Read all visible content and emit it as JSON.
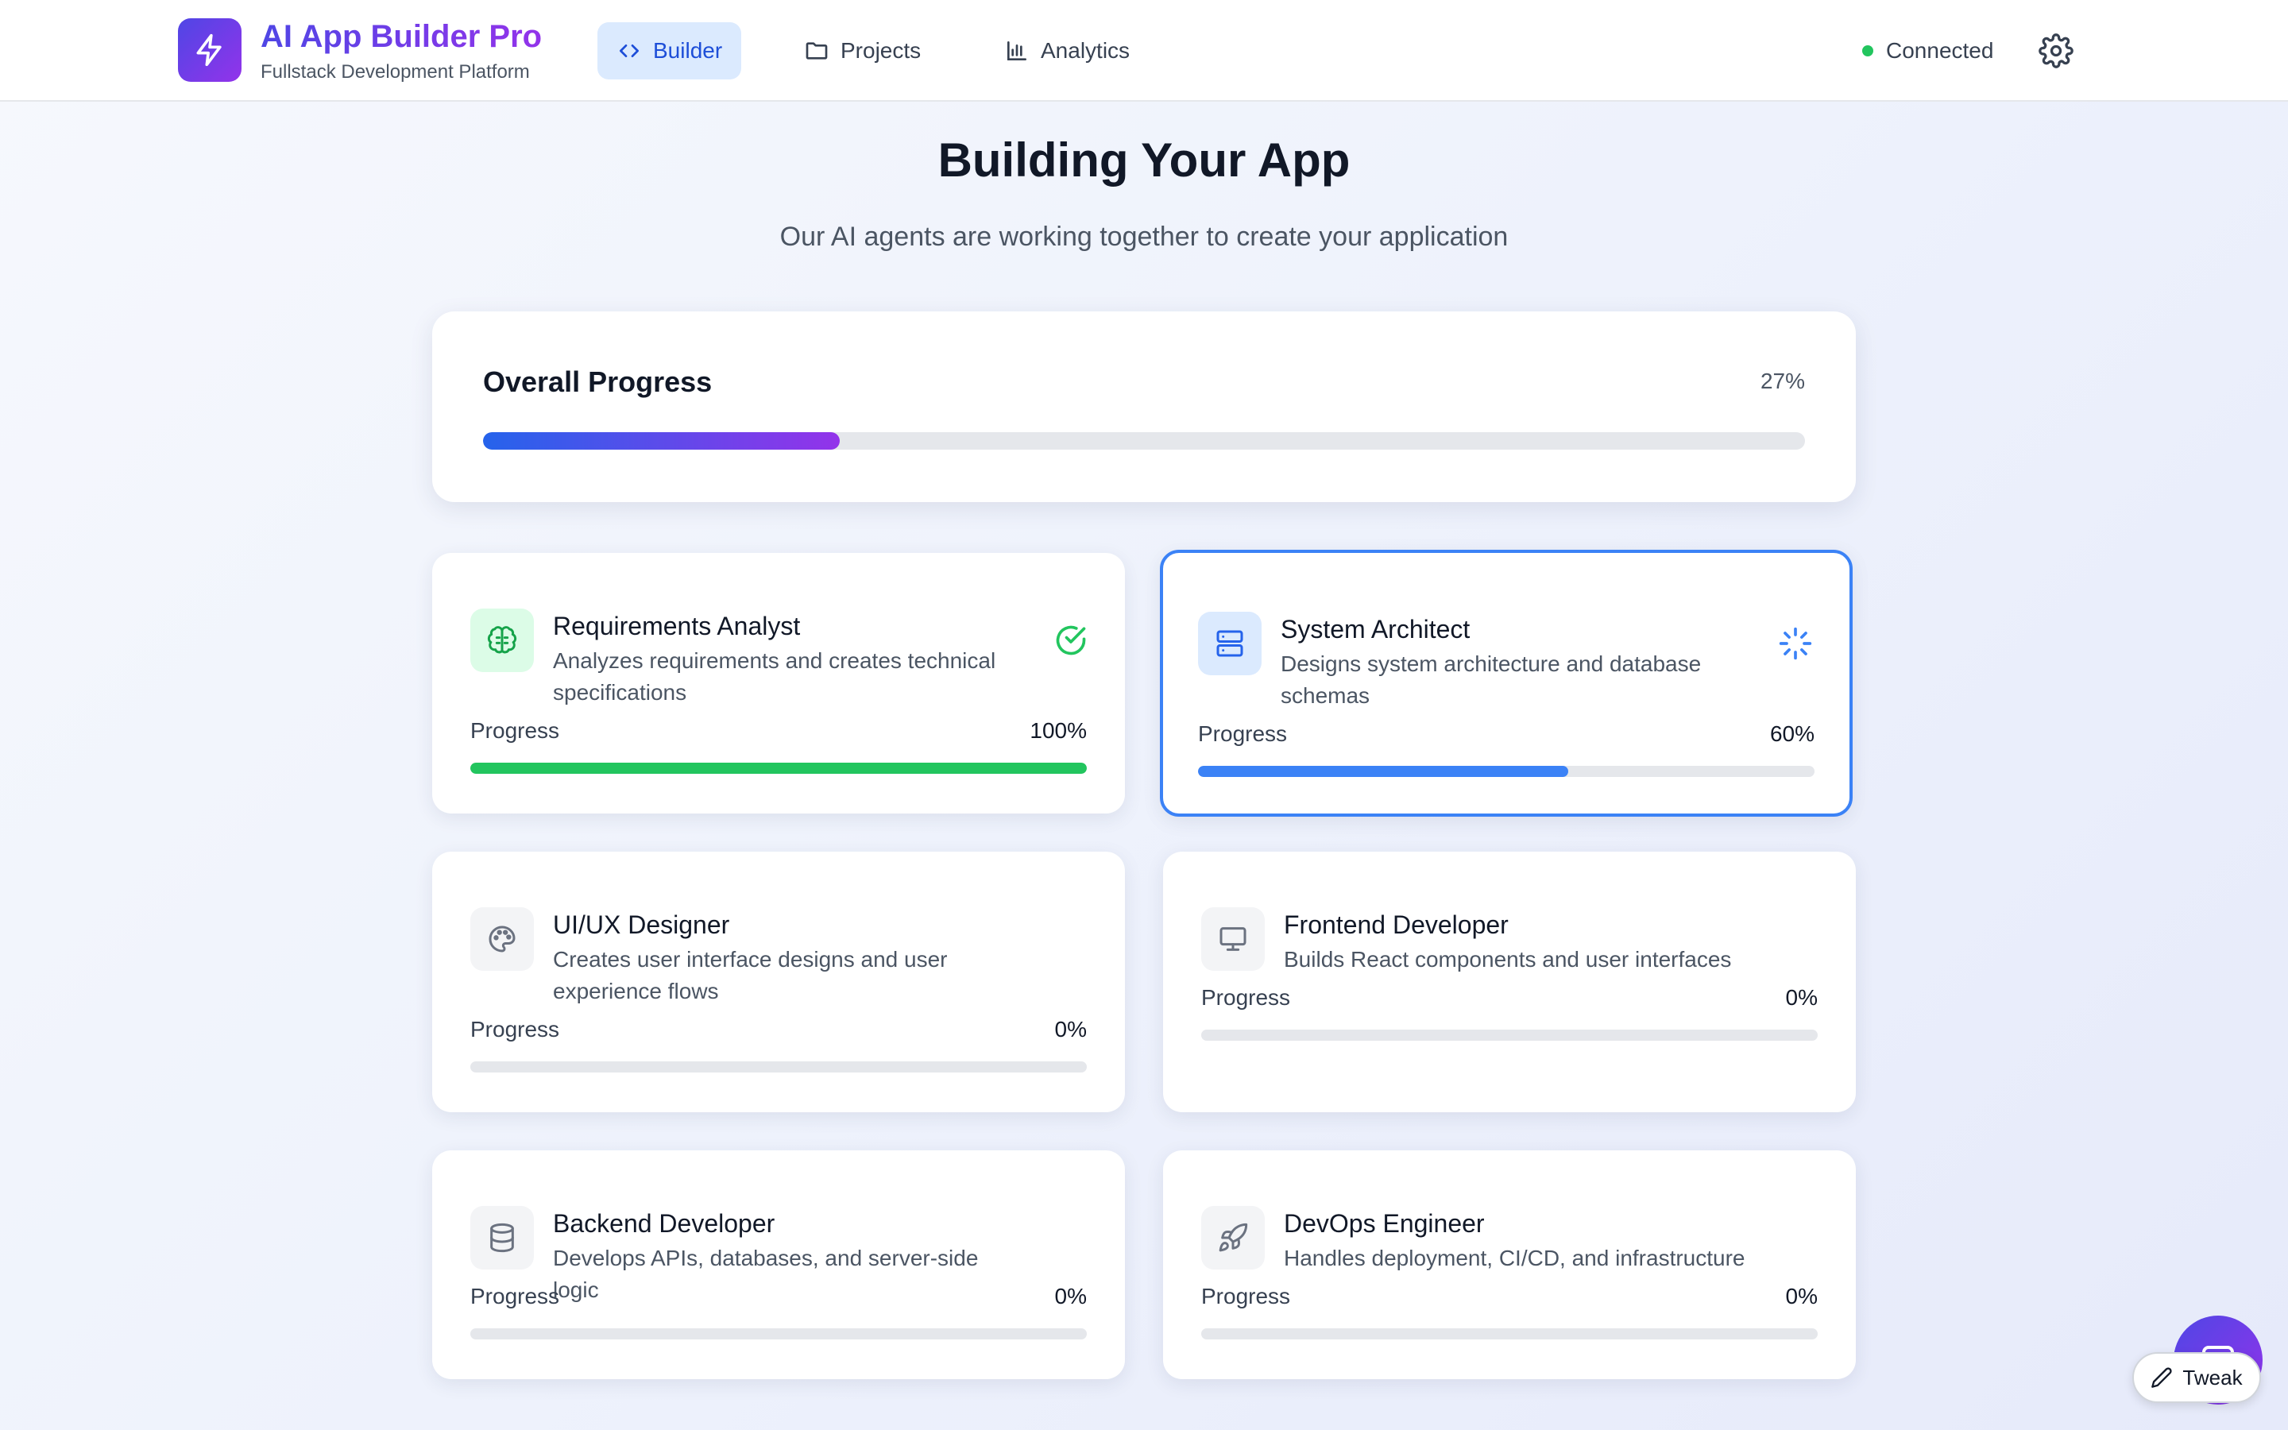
{
  "header": {
    "app_title": "AI App Builder Pro",
    "app_subtitle": "Fullstack Development Platform",
    "logo_icon": "lightning-bolt-icon",
    "nav": [
      {
        "label": "Builder",
        "icon": "code-icon",
        "active": true
      },
      {
        "label": "Projects",
        "icon": "folder-icon",
        "active": false
      },
      {
        "label": "Analytics",
        "icon": "bar-chart-icon",
        "active": false
      }
    ],
    "status_label": "Connected",
    "settings_icon": "gear-icon"
  },
  "main": {
    "title": "Building Your App",
    "subtitle": "Our AI agents are working together to create your application",
    "overall": {
      "label": "Overall Progress",
      "percent_text": "27%",
      "percent": 27
    },
    "progress_label": "Progress",
    "agents": [
      {
        "name": "Requirements Analyst",
        "desc": "Analyzes requirements and creates technical specifications",
        "percent_text": "100%",
        "percent": 100,
        "icon": "brain-icon",
        "status": "complete",
        "status_icon": "check-circle-icon",
        "color": "#22c55e"
      },
      {
        "name": "System Architect",
        "desc": "Designs system architecture and database schemas",
        "percent_text": "60%",
        "percent": 60,
        "icon": "server-icon",
        "status": "in-progress",
        "status_icon": "spinner-icon",
        "color": "#3b82f6"
      },
      {
        "name": "UI/UX Designer",
        "desc": "Creates user interface designs and user experience flows",
        "percent_text": "0%",
        "percent": 0,
        "icon": "palette-icon",
        "status": "pending",
        "color": "#9ca3af"
      },
      {
        "name": "Frontend Developer",
        "desc": "Builds React components and user interfaces",
        "percent_text": "0%",
        "percent": 0,
        "icon": "monitor-icon",
        "status": "pending",
        "color": "#9ca3af"
      },
      {
        "name": "Backend Developer",
        "desc": "Develops APIs, databases, and server-side logic",
        "percent_text": "0%",
        "percent": 0,
        "icon": "database-icon",
        "status": "pending",
        "color": "#9ca3af"
      },
      {
        "name": "DevOps Engineer",
        "desc": "Handles deployment, CI/CD, and infrastructure",
        "percent_text": "0%",
        "percent": 0,
        "icon": "rocket-icon",
        "status": "pending",
        "color": "#9ca3af"
      }
    ]
  },
  "floating": {
    "tweak_label": "Tweak",
    "tweak_icon": "pencil-icon",
    "chat_icon": "chat-icon"
  },
  "colors": {
    "accent_start": "#4f46e5",
    "accent_end": "#9333ea",
    "complete": "#22c55e",
    "active": "#3b82f6",
    "connected": "#22c55e"
  }
}
